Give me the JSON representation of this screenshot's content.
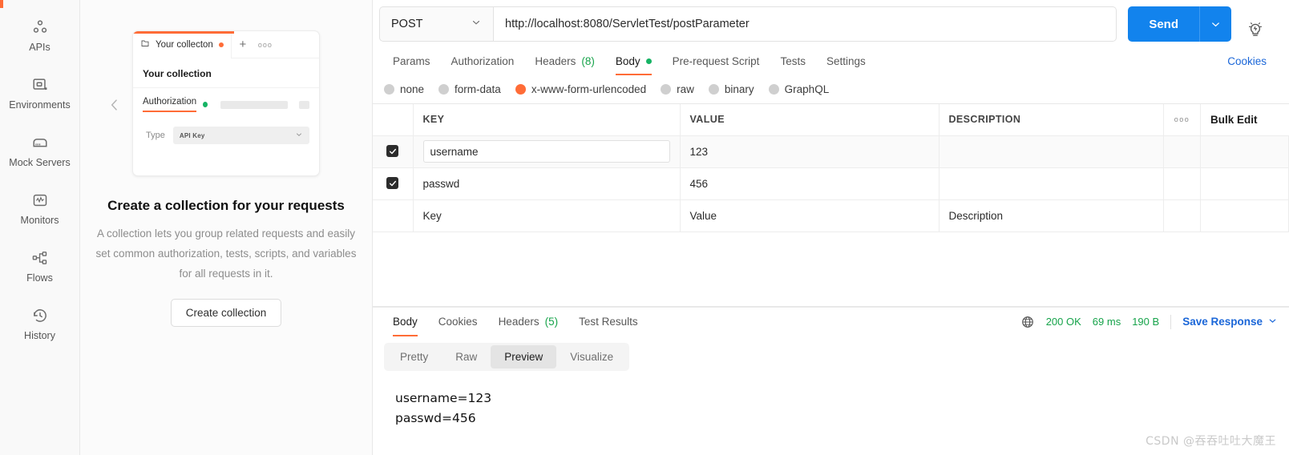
{
  "sidebar": {
    "items": [
      {
        "label": "APIs",
        "icon": "apis-icon"
      },
      {
        "label": "Environments",
        "icon": "environments-icon"
      },
      {
        "label": "Mock Servers",
        "icon": "mock-servers-icon"
      },
      {
        "label": "Monitors",
        "icon": "monitors-icon"
      },
      {
        "label": "Flows",
        "icon": "flows-icon"
      },
      {
        "label": "History",
        "icon": "history-icon"
      }
    ]
  },
  "collection_pane": {
    "collapse_icon": "chevron-left-icon",
    "preview_card": {
      "tab_label": "Your collecton",
      "tab_dot": "unsaved-dot",
      "plus_label": "+",
      "more_label": "ooo",
      "title": "Your collection",
      "auth_tab_label": "Authorization",
      "type_label": "Type",
      "type_value": "API Key"
    },
    "empty_title": "Create a collection for your requests",
    "empty_desc": "A collection lets you group related requests and easily set common authorization, tests, scripts, and variables for all requests in it.",
    "create_button": "Create collection"
  },
  "request": {
    "method": "POST",
    "method_caret": "chevron-down-icon",
    "url": "http://localhost:8080/ServletTest/postParameter",
    "send_label": "Send",
    "send_caret": "chevron-down-icon",
    "bulb_icon": "lightbulb-icon",
    "cookies_label": "Cookies",
    "tabs": [
      {
        "label": "Params",
        "count": "",
        "active": false,
        "dot": false
      },
      {
        "label": "Authorization",
        "count": "",
        "active": false,
        "dot": false
      },
      {
        "label": "Headers",
        "count": "(8)",
        "active": false,
        "dot": false
      },
      {
        "label": "Body",
        "count": "",
        "active": true,
        "dot": true
      },
      {
        "label": "Pre-request Script",
        "count": "",
        "active": false,
        "dot": false
      },
      {
        "label": "Tests",
        "count": "",
        "active": false,
        "dot": false
      },
      {
        "label": "Settings",
        "count": "",
        "active": false,
        "dot": false
      }
    ],
    "body_types": [
      {
        "label": "none",
        "selected": false
      },
      {
        "label": "form-data",
        "selected": false
      },
      {
        "label": "x-www-form-urlencoded",
        "selected": true
      },
      {
        "label": "raw",
        "selected": false
      },
      {
        "label": "binary",
        "selected": false
      },
      {
        "label": "GraphQL",
        "selected": false
      }
    ],
    "table": {
      "headers": {
        "key": "KEY",
        "value": "VALUE",
        "description": "DESCRIPTION",
        "more": "ooo",
        "bulk_edit": "Bulk Edit"
      },
      "rows": [
        {
          "checked": true,
          "key": "username",
          "value": "123",
          "description": ""
        },
        {
          "checked": true,
          "key": "passwd",
          "value": "456",
          "description": ""
        }
      ],
      "placeholder_row": {
        "key": "Key",
        "value": "Value",
        "description": "Description"
      }
    }
  },
  "response": {
    "tabs": [
      {
        "label": "Body",
        "count": "",
        "active": true
      },
      {
        "label": "Cookies",
        "count": "",
        "active": false
      },
      {
        "label": "Headers",
        "count": "(5)",
        "active": false
      },
      {
        "label": "Test Results",
        "count": "",
        "active": false
      }
    ],
    "globe_icon": "globe-icon",
    "status": "200 OK",
    "time": "69 ms",
    "size": "190 B",
    "save_response": "Save Response",
    "save_caret": "chevron-down-icon",
    "view_modes": [
      {
        "label": "Pretty",
        "active": false
      },
      {
        "label": "Raw",
        "active": false
      },
      {
        "label": "Preview",
        "active": true
      },
      {
        "label": "Visualize",
        "active": false
      }
    ],
    "body_lines": [
      "username=123",
      "passwd=456"
    ]
  },
  "watermark": "CSDN @吞吞吐吐大魔王",
  "colors": {
    "accent_orange": "#ff6c37",
    "send_blue": "#1283ed",
    "link_blue": "#1a66d8",
    "status_green": "#16a34a"
  }
}
